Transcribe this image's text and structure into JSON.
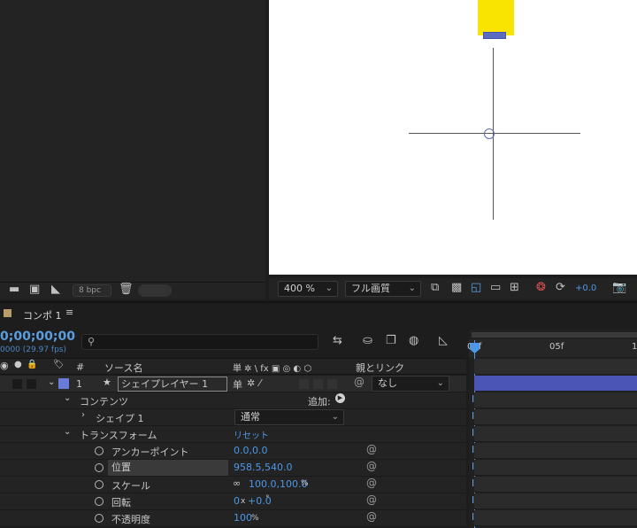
{
  "left_panel": {
    "bpc_label": "8 bpc"
  },
  "viewer": {
    "zoom": "400 %",
    "quality": "フル画質",
    "exposure": "+0.0"
  },
  "timeline": {
    "tab_label": "コンポ 1",
    "timecode": "0;00;00;00",
    "fps_label": "0000 (29.97 fps)",
    "ruler_ticks": [
      "00f",
      "05f",
      "1"
    ],
    "columns": {
      "number": "#",
      "source_name": "ソース名",
      "switches": "単 ✲ \\ fx ▣ ◎ ◐ ⬡",
      "parent": "親とリンク"
    },
    "layer": {
      "number": "1",
      "name": "シェイプレイヤー 1",
      "parent_value": "なし"
    },
    "contents": {
      "label": "コンテンツ",
      "add_label": "追加:",
      "shape_label": "シェイプ 1",
      "blend_mode": "通常"
    },
    "transform": {
      "label": "トランスフォーム",
      "reset_label": "リセット",
      "properties": [
        {
          "name": "アンカーポイント",
          "value": "0.0,0.0"
        },
        {
          "name": "位置",
          "value": "958.5,540.0"
        },
        {
          "name": "スケール",
          "value": "100.0,100.0",
          "unit": "%"
        },
        {
          "name": "回転",
          "value": "0",
          "value2": "+0.0",
          "unit": "°"
        },
        {
          "name": "不透明度",
          "value": "100",
          "unit": "%"
        }
      ]
    }
  }
}
